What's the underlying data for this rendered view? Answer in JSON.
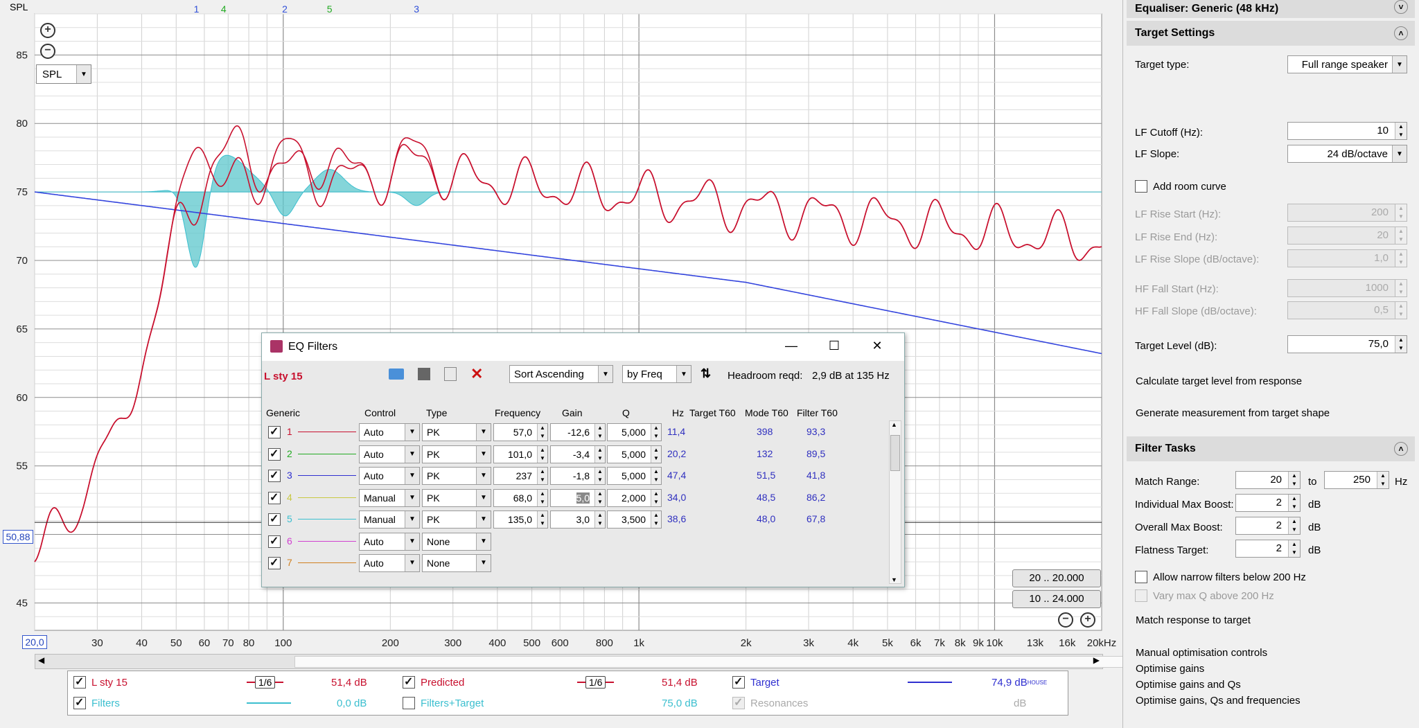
{
  "graph": {
    "y_axis_label": "SPL",
    "spl_select": "SPL",
    "marker_level": "50,88",
    "x_start": "20,0",
    "y_ticks": [
      "85",
      "80",
      "75",
      "70",
      "65",
      "60",
      "55",
      "50",
      "45"
    ],
    "x_ticks": [
      "30",
      "40",
      "50",
      "60",
      "70",
      "80",
      "100",
      "200",
      "300",
      "400",
      "500",
      "600",
      "800",
      "1k",
      "2k",
      "3k",
      "4k",
      "5k",
      "6k",
      "7k",
      "8k",
      "9k",
      "10k",
      "13k",
      "16k",
      "20kHz"
    ],
    "filter_markers": [
      {
        "label": "1",
        "color": "#2f4fd8"
      },
      {
        "label": "4",
        "color": "#22aa22"
      },
      {
        "label": "2",
        "color": "#2f4fd8"
      },
      {
        "label": "5",
        "color": "#22aa22"
      },
      {
        "label": "3",
        "color": "#2f4fd8"
      }
    ],
    "range_buttons": [
      "20 .. 20.000",
      "10 .. 24.000"
    ]
  },
  "legend": {
    "items": [
      {
        "name": "L sty 15",
        "checked": true,
        "color": "#c8102e",
        "smoothing": "1/6",
        "value": "51,4 dB"
      },
      {
        "name": "Predicted",
        "checked": true,
        "color": "#c8102e",
        "smoothing": "1/6",
        "value": "51,4 dB"
      },
      {
        "name": "Target",
        "checked": true,
        "color": "#2f2fd0",
        "value": "74,9 dB",
        "sup": "HOUSE"
      },
      {
        "name": "Filters",
        "checked": true,
        "color": "#3bbfcf",
        "value": "0,0 dB"
      },
      {
        "name": "Filters+Target",
        "checked": false,
        "color": "#3bbfcf",
        "value": "75,0 dB"
      },
      {
        "name": "Resonances",
        "checked": true,
        "disabled": true,
        "color": "#aaaaaa",
        "value": "dB"
      }
    ]
  },
  "eq_window": {
    "title": "EQ Filters",
    "measurement": "L sty 15",
    "sort": "Sort Ascending",
    "sort_by": "by Freq",
    "headroom_label": "Headroom reqd:",
    "headroom_value": "2,9 dB at 135 Hz",
    "columns": {
      "generic": "Generic",
      "control": "Control",
      "type": "Type",
      "frequency": "Frequency",
      "gain": "Gain",
      "q": "Q",
      "hz": "Hz",
      "target_t60": "Target T60",
      "mode_t60": "Mode T60",
      "filter_t60": "Filter T60"
    },
    "rows": [
      {
        "n": "1",
        "color": "#c8102e",
        "control": "Auto",
        "type": "PK",
        "freq": "57,0",
        "gain": "-12,6",
        "q": "5,000",
        "hz": "11,4",
        "mode": "398",
        "filter": "93,3"
      },
      {
        "n": "2",
        "color": "#22aa22",
        "control": "Auto",
        "type": "PK",
        "freq": "101,0",
        "gain": "-3,4",
        "q": "5,000",
        "hz": "20,2",
        "mode": "132",
        "filter": "89,5"
      },
      {
        "n": "3",
        "color": "#2f2fd0",
        "control": "Auto",
        "type": "PK",
        "freq": "237",
        "gain": "-1,8",
        "q": "5,000",
        "hz": "47,4",
        "mode": "51,5",
        "filter": "41,8"
      },
      {
        "n": "4",
        "color": "#c8c840",
        "control": "Manual",
        "type": "PK",
        "freq": "68,0",
        "gain": "5,0",
        "q": "2,000",
        "hz": "34,0",
        "mode": "48,5",
        "filter": "86,2"
      },
      {
        "n": "5",
        "color": "#3bbfcf",
        "control": "Manual",
        "type": "PK",
        "freq": "135,0",
        "gain": "3,0",
        "q": "3,500",
        "hz": "38,6",
        "mode": "48,0",
        "filter": "67,8"
      },
      {
        "n": "6",
        "color": "#d040d0",
        "control": "Auto",
        "type": "None"
      },
      {
        "n": "7",
        "color": "#d08020",
        "control": "Auto",
        "type": "None"
      }
    ]
  },
  "right_panel": {
    "equaliser_header": "Equaliser: Generic (48 kHz)",
    "target_header": "Target Settings",
    "target_type_label": "Target type:",
    "target_type": "Full range speaker",
    "lf_cutoff_label": "LF Cutoff (Hz):",
    "lf_cutoff": "10",
    "lf_slope_label": "LF Slope:",
    "lf_slope": "24 dB/octave",
    "add_room_curve": "Add room curve",
    "lf_rise_start_label": "LF Rise Start (Hz):",
    "lf_rise_start": "200",
    "lf_rise_end_label": "LF Rise End (Hz):",
    "lf_rise_end": "20",
    "lf_rise_slope_label": "LF Rise Slope (dB/octave):",
    "lf_rise_slope": "1,0",
    "hf_fall_start_label": "HF Fall Start (Hz):",
    "hf_fall_start": "1000",
    "hf_fall_slope_label": "HF Fall Slope (dB/octave):",
    "hf_fall_slope": "0,5",
    "target_level_label": "Target Level (dB):",
    "target_level": "75,0",
    "calc_target": "Calculate target level from response",
    "gen_measurement": "Generate measurement from target shape",
    "filter_tasks_header": "Filter Tasks",
    "match_range_label": "Match Range:",
    "match_from": "20",
    "to_label": "to",
    "match_to": "250",
    "hz_label": "Hz",
    "ind_max_boost_label": "Individual Max Boost:",
    "ind_max_boost": "2",
    "overall_max_boost_label": "Overall Max Boost:",
    "overall_max_boost": "2",
    "flatness_label": "Flatness Target:",
    "flatness": "2",
    "db_label": "dB",
    "allow_narrow": "Allow narrow filters below 200 Hz",
    "vary_q": "Vary max Q above 200 Hz",
    "match_response": "Match response to target",
    "manual_opt": "Manual optimisation controls",
    "opt_gains": "Optimise gains",
    "opt_gains_q": "Optimise gains and Qs",
    "opt_gains_q_f": "Optimise gains, Qs and frequencies"
  }
}
